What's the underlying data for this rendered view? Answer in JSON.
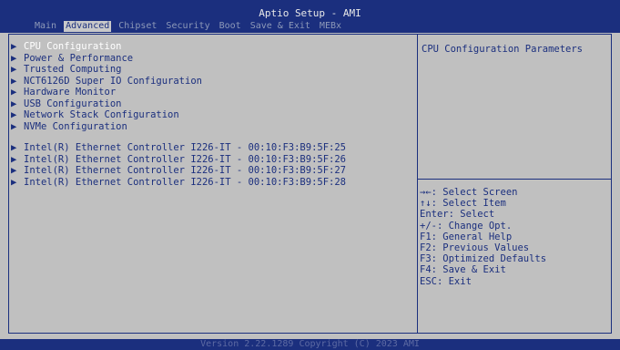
{
  "header": {
    "title": "Aptio Setup - AMI",
    "tabs": [
      {
        "label": "Main"
      },
      {
        "label": "Advanced"
      },
      {
        "label": "Chipset"
      },
      {
        "label": "Security"
      },
      {
        "label": "Boot"
      },
      {
        "label": "Save & Exit"
      },
      {
        "label": "MEBx"
      }
    ],
    "active_tab": "Advanced"
  },
  "menu": {
    "arrow": "▶",
    "items": [
      {
        "label": "CPU Configuration",
        "selected": true
      },
      {
        "label": "Power & Performance"
      },
      {
        "label": "Trusted Computing"
      },
      {
        "label": "NCT6126D Super IO Configuration"
      },
      {
        "label": "Hardware Monitor"
      },
      {
        "label": "USB Configuration"
      },
      {
        "label": "Network Stack Configuration"
      },
      {
        "label": "NVMe Configuration"
      },
      {
        "label": "Intel(R) Ethernet Controller I226-IT - 00:10:F3:B9:5F:25"
      },
      {
        "label": "Intel(R) Ethernet Controller I226-IT - 00:10:F3:B9:5F:26"
      },
      {
        "label": "Intel(R) Ethernet Controller I226-IT - 00:10:F3:B9:5F:27"
      },
      {
        "label": "Intel(R) Ethernet Controller I226-IT - 00:10:F3:B9:5F:28"
      }
    ]
  },
  "help": {
    "description": "CPU Configuration Parameters",
    "keys": [
      "→←: Select Screen",
      "↑↓: Select Item",
      "Enter: Select",
      "+/-: Change Opt.",
      "F1: General Help",
      "F2: Previous Values",
      "F3: Optimized Defaults",
      "F4: Save & Exit",
      "ESC: Exit"
    ]
  },
  "footer": {
    "text": "Version 2.22.1289 Copyright (C) 2023 AMI"
  },
  "colors": {
    "header_bg": "#1b2f7e",
    "body_bg": "#c0c0c0",
    "text": "#1b2f7e",
    "selected_text": "#ffffff",
    "inactive_tab": "#8d99b8"
  }
}
